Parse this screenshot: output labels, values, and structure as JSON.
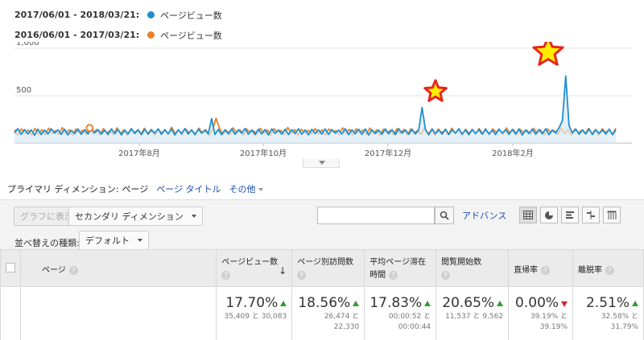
{
  "legend": [
    {
      "range": "2017/06/01 - 2018/03/21:",
      "label": "ページビュー数",
      "color": "#1f8fcf"
    },
    {
      "range": "2016/06/01 - 2017/03/21:",
      "label": "ページビュー数",
      "color": "#e8822a"
    }
  ],
  "chart_data": {
    "type": "line",
    "ylim": [
      0,
      1000
    ],
    "yticks": [
      "1,000",
      "500"
    ],
    "xticks": [
      "2017年8月",
      "2017年10月",
      "2017年12月",
      "2018年2月"
    ],
    "highlights": [
      "2017年12月",
      "2018年2月"
    ],
    "series": [
      {
        "name": "2017/06/01 - 2018/03/21: ページビュー数",
        "color": "#1f8fcf",
        "values": [
          106,
          152,
          92,
          142,
          96,
          138,
          83,
          147,
          90,
          137,
          95,
          150,
          104,
          140,
          92,
          146,
          86,
          135,
          100,
          148,
          92,
          140,
          97,
          156,
          107,
          142,
          95,
          137,
          90,
          150,
          99,
          144,
          86,
          137,
          96,
          152,
          101,
          141,
          89,
          147,
          94,
          138,
          104,
          150,
          92,
          142,
          97,
          149,
          86,
          140,
          100,
          153,
          94,
          141,
          88,
          147,
          105,
          137,
          96,
          258,
          91,
          144,
          87,
          139,
          98,
          150,
          92,
          140,
          103,
          155,
          94,
          138,
          89,
          147,
          97,
          142,
          85,
          150,
          102,
          139,
          94,
          146,
          90,
          141,
          99,
          152,
          93,
          138,
          87,
          145,
          101,
          139,
          95,
          149,
          91,
          143,
          104,
          137,
          96,
          152,
          88,
          140,
          98,
          146,
          92,
          150,
          86,
          141,
          100,
          137,
          93,
          149,
          97,
          142,
          89,
          151,
          105,
          138,
          92,
          146,
          96,
          140,
          375,
          143,
          87,
          150,
          99,
          138,
          94,
          147,
          91,
          141,
          103,
          152,
          95,
          139,
          88,
          145,
          100,
          142,
          93,
          150,
          97,
          137,
          90,
          148,
          104,
          141,
          92,
          144,
          96,
          150,
          86,
          139,
          101,
          147,
          94,
          142,
          98,
          151,
          89,
          137,
          106,
          163,
          235,
          708,
          182,
          107,
          148,
          93,
          140,
          97,
          150,
          90,
          142,
          102,
          138,
          95,
          147,
          88,
          141
        ]
      },
      {
        "name": "2016/06/01 - 2017/03/21: ページビュー数",
        "color": "#e8822a",
        "values": [
          143,
          85,
          150,
          98,
          137,
          82,
          153,
          94,
          141,
          87,
          157,
          103,
          132,
          90,
          163,
          98,
          140,
          81,
          149,
          107,
          136,
          92,
          159,
          95,
          143,
          85,
          152,
          104,
          131,
          88,
          160,
          99,
          138,
          83,
          146,
          110,
          134,
          91,
          156,
          97,
          145,
          81,
          150,
          106,
          132,
          94,
          167,
          100,
          137,
          84,
          149,
          112,
          131,
          88,
          158,
          102,
          140,
          80,
          145,
          262,
          155,
          96,
          135,
          87,
          161,
          104,
          141,
          83,
          147,
          109,
          130,
          93,
          155,
          99,
          138,
          86,
          151,
          111,
          133,
          89,
          164,
          101,
          142,
          80,
          146,
          106,
          135,
          96,
          153,
          93,
          139,
          84,
          148,
          115,
          131,
          87,
          160,
          103,
          144,
          82,
          151,
          108,
          136,
          94,
          158,
          98,
          140,
          81,
          147,
          112,
          132,
          90,
          154,
          100,
          145,
          85,
          150,
          105,
          134,
          92,
          162,
          96,
          137,
          83,
          148,
          110,
          133,
          88,
          157,
          102,
          141,
          80,
          146,
          107,
          136,
          95,
          153,
          97,
          139,
          84,
          150,
          114,
          131,
          91,
          159,
          104,
          143,
          86,
          145,
          109,
          135,
          93,
          156,
          99,
          138,
          82,
          149,
          111,
          132,
          89,
          161,
          101,
          142,
          85,
          147,
          106,
          134,
          96,
          154,
          94,
          140,
          83,
          151,
          113,
          136,
          90,
          158
        ]
      }
    ]
  },
  "dimension": {
    "title": "プライマリ ディメンション:",
    "current": "ページ",
    "links": [
      "ページ タイトル",
      "その他"
    ]
  },
  "toolbar": {
    "graph_btn": "グラフに表示",
    "secondary_dim": "セカンダリ ディメンション",
    "search_value": "",
    "advanced": "アドバンス",
    "sort_label": "並べ替えの種類:",
    "sort_value": "デフォルト"
  },
  "table": {
    "headers": [
      {
        "label": "ページ"
      },
      {
        "label": "ページビュー数"
      },
      {
        "label": "ページ別訪問数"
      },
      {
        "label": "平均ページ滞在時間"
      },
      {
        "label": "閲覧開始数"
      },
      {
        "label": "直帰率"
      },
      {
        "label": "離脱率"
      }
    ],
    "summary": [
      {
        "pct": "17.70%",
        "trend": "up",
        "cmp1": "35,409 と 30,083",
        "cmp2": ""
      },
      {
        "pct": "18.56%",
        "trend": "up",
        "cmp1": "26,474 と",
        "cmp2": "22,330"
      },
      {
        "pct": "17.83%",
        "trend": "up",
        "cmp1": "00:00:52 と",
        "cmp2": "00:00:44"
      },
      {
        "pct": "20.65%",
        "trend": "up",
        "cmp1": "11,537 と 9,562",
        "cmp2": ""
      },
      {
        "pct": "0.00%",
        "trend": "down",
        "cmp1": "39.19% と",
        "cmp2": "39.19%"
      },
      {
        "pct": "2.51%",
        "trend": "up",
        "cmp1": "32.58% と",
        "cmp2": "31.79%"
      }
    ]
  }
}
